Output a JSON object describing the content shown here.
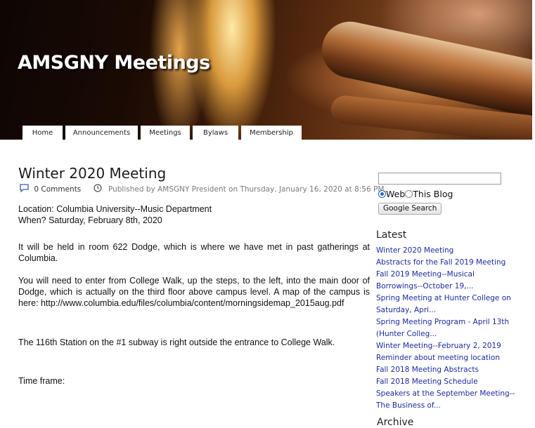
{
  "header": {
    "title": "AMSGNY Meetings"
  },
  "nav": [
    {
      "label": "Home",
      "w": 57
    },
    {
      "label": "Announcements",
      "w": 103
    },
    {
      "label": "Meetings",
      "w": 70
    },
    {
      "label": "Bylaws",
      "w": 65
    },
    {
      "label": "Membership",
      "w": 86
    }
  ],
  "post": {
    "title": "Winter 2020 Meeting",
    "comments": "0 Comments",
    "published": "Published by AMSGNY President on Thursday, January 16, 2020 at 8:56 PM.",
    "p1_l1": "Location:  Columbia University--Music Department",
    "p1_l2": "When?  Saturday, February 8th, 2020",
    "p2": "It will be held in room 622 Dodge, which is where we have met in past gatherings at Columbia.",
    "p3": "You will need to enter from College Walk, up the steps, to the left, into the main door of Dodge, which is actually on the third floor above campus level.  A map of the campus is here: http://www.columbia.edu/files/columbia/content/morningsidemap_2015aug.pdf",
    "p4": "The 116th Station on the #1 subway is right outside the entrance to College Walk.",
    "p5": "Time frame:"
  },
  "search": {
    "input_value": "",
    "option_web": "Web",
    "option_blog": "This Blog",
    "button": "Google Search"
  },
  "sidebar": {
    "latest_heading": "Latest",
    "latest_items": [
      "Winter 2020 Meeting",
      "Abstracts for the Fall 2019 Meeting",
      "Fall 2019 Meeting--Musical",
      "Borrowings--October 19,...",
      "Spring Meeting at Hunter College on",
      "Saturday, Apri...",
      "Spring Meeting Program - April 13th",
      "(Hunter Colleg...",
      "Winter Meeting--February 2, 2019",
      "Reminder about meeting location",
      "Fall 2018 Meeting Abstracts",
      "Fall 2018 Meeting Schedule",
      "Speakers at the September Meeting--",
      "The Business of..."
    ],
    "partial_heading": "Archive"
  }
}
